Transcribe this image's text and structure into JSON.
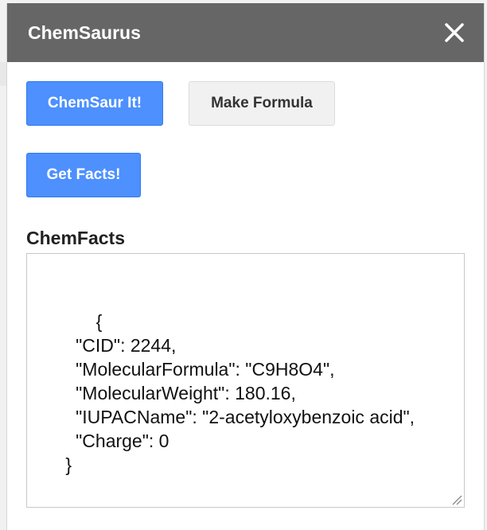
{
  "dialog": {
    "title": "ChemSaurus",
    "close_icon": "close-icon"
  },
  "buttons": {
    "chemsaur_label": "ChemSaur It!",
    "make_formula_label": "Make Formula",
    "get_facts_label": "Get Facts!"
  },
  "chemfacts": {
    "label": "ChemFacts",
    "value": "      {\n        \"CID\": 2244,\n        \"MolecularFormula\": \"C9H8O4\",\n        \"MolecularWeight\": 180.16,\n        \"IUPACName\": \"2-acetyloxybenzoic acid\",\n        \"Charge\": 0\n      }"
  },
  "colors": {
    "titlebar": "#666666",
    "primary_button": "#4d90fe",
    "secondary_button": "#f1f1f1"
  }
}
